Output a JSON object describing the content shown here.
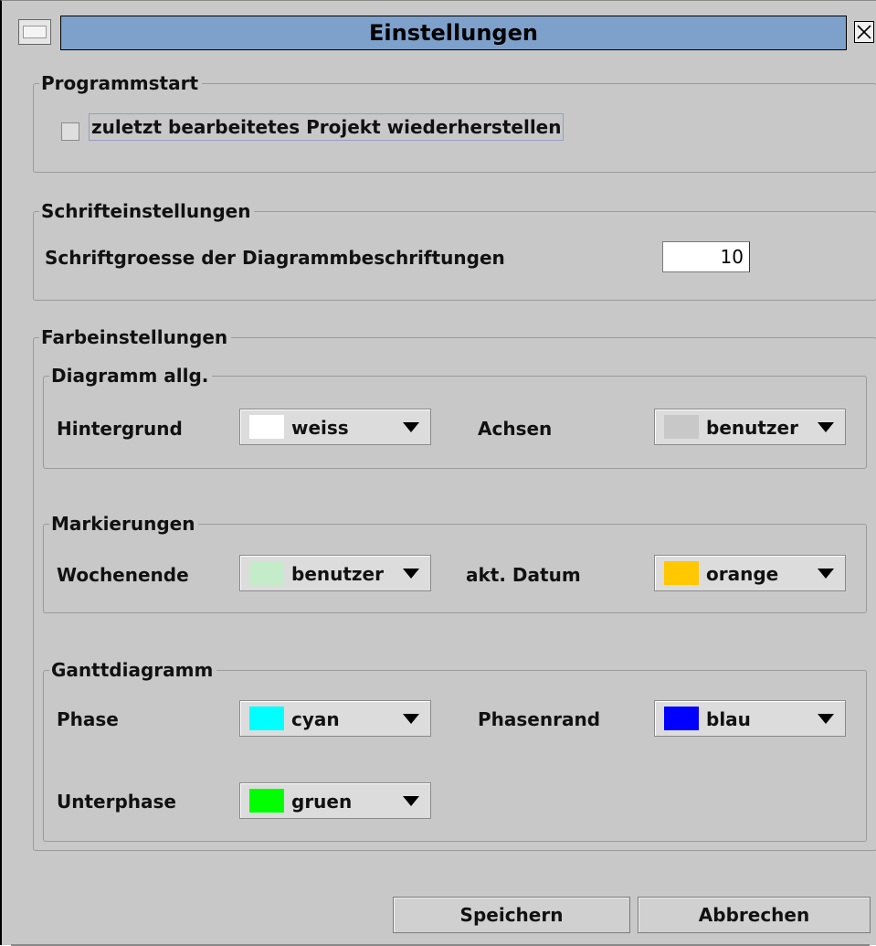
{
  "window": {
    "title": "Einstellungen"
  },
  "programmstart": {
    "legend": "Programmstart",
    "restore_checkbox": {
      "label": "zuletzt bearbeitetes Projekt wiederherstellen",
      "checked": false
    }
  },
  "schrift": {
    "legend": "Schrifteinstellungen",
    "size_label": "Schriftgroesse der Diagrammbeschriftungen",
    "size_value": "10"
  },
  "farben": {
    "legend": "Farbeinstellungen",
    "diagramm": {
      "legend": "Diagramm allg.",
      "hintergrund": {
        "label": "Hintergrund",
        "value": "weiss",
        "color": "#ffffff"
      },
      "achsen": {
        "label": "Achsen",
        "value": "benutzer",
        "color": "#c8c8c8"
      }
    },
    "markierungen": {
      "legend": "Markierungen",
      "wochenende": {
        "label": "Wochenende",
        "value": "benutzer",
        "color": "#c4ecc8"
      },
      "datum": {
        "label": "akt. Datum",
        "value": "orange",
        "color": "#ffc800"
      }
    },
    "gantt": {
      "legend": "Ganttdiagramm",
      "phase": {
        "label": "Phase",
        "value": "cyan",
        "color": "#00ffff"
      },
      "phasenrand": {
        "label": "Phasenrand",
        "value": "blau",
        "color": "#0000ff"
      },
      "unterphase": {
        "label": "Unterphase",
        "value": "gruen",
        "color": "#00ff00"
      }
    }
  },
  "buttons": {
    "save": "Speichern",
    "cancel": "Abbrechen"
  }
}
